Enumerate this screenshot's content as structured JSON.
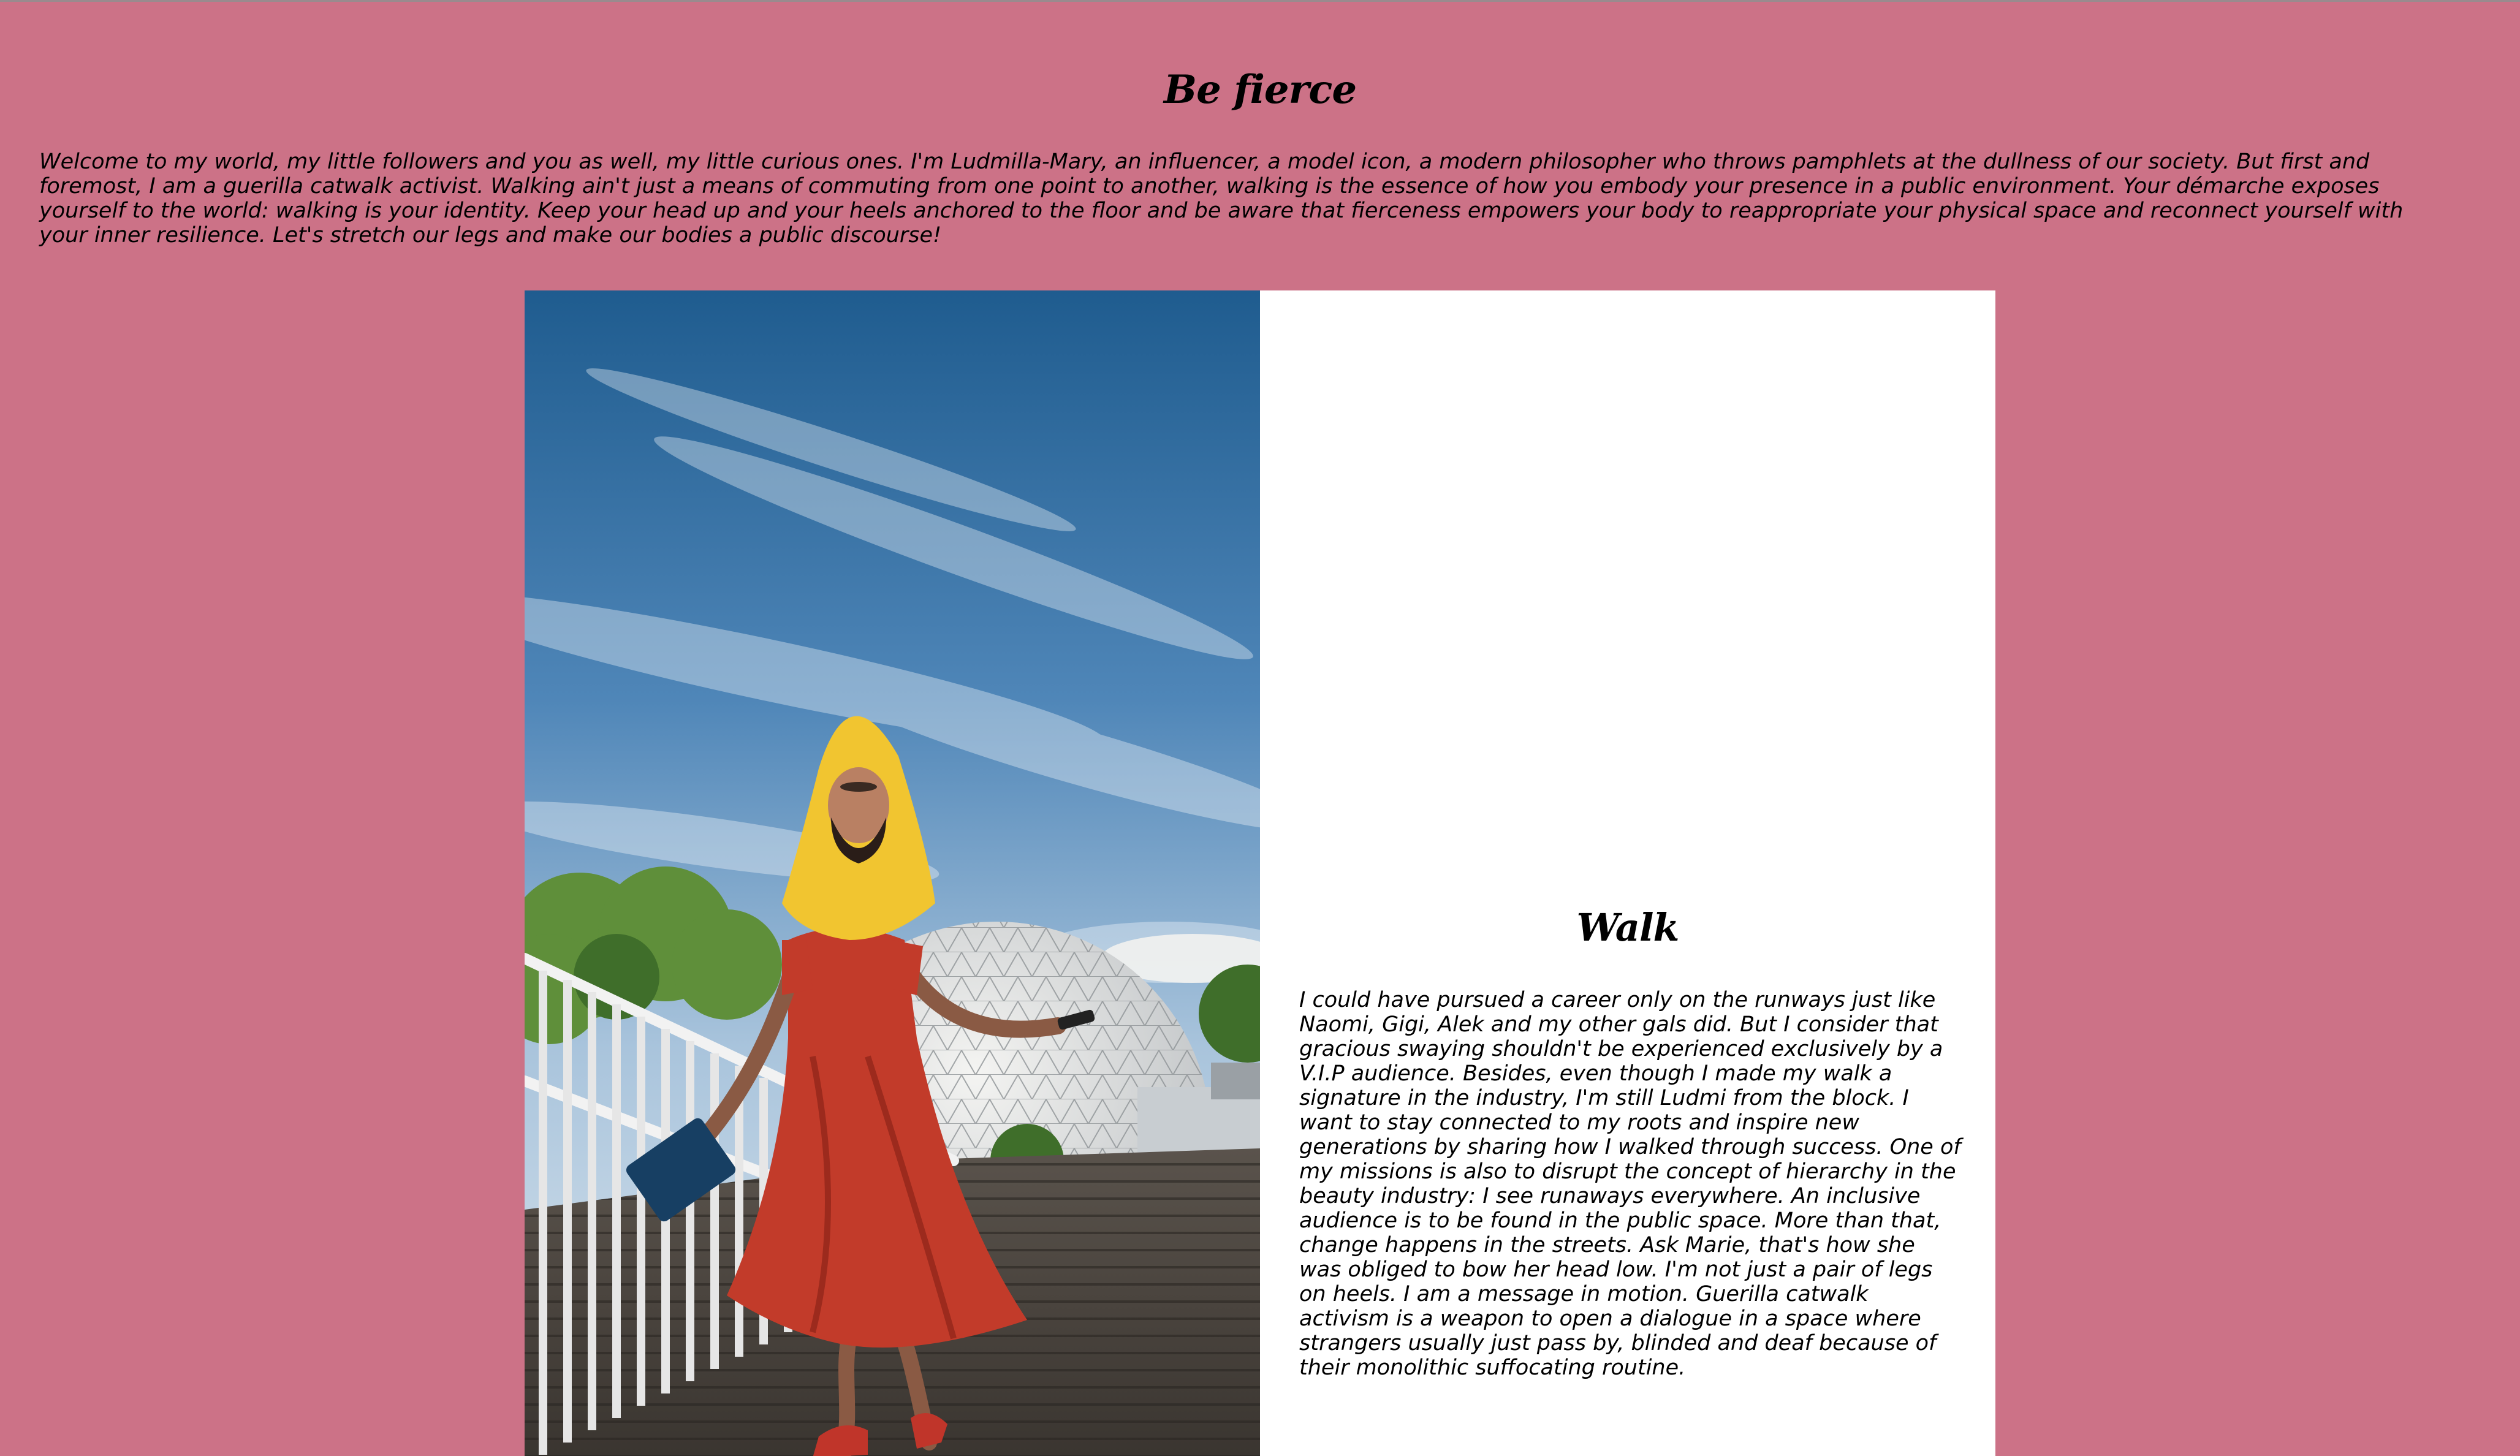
{
  "page": {
    "title": "Be fierce",
    "intro": "Welcome to my world, my little followers and you as well, my little curious ones. I'm Ludmilla-Mary, an influencer, a model icon, a modern philosopher who throws pamphlets at the dullness of our society. But first and foremost, I am a guerilla catwalk activist. Walking ain't just a means of commuting from one point to another, walking is the essence of how you embody your presence in a public environment. Your démarche exposes yourself to the world: walking is your identity. Keep your head up and your heels anchored to the floor and be aware that fierceness empowers your body to reappropriate your physical space and reconnect yourself with your inner resilience. Let's stretch our legs and make our bodies a public discourse!"
  },
  "section": {
    "title": "Walk",
    "body": "I could have pursued a career only on the runways just like Naomi, Gigi, Alek and my other gals did. But I consider that gracious swaying shouldn't be experienced exclusively by a V.I.P audience. Besides, even though I made my walk a signature in the industry, I'm still Ludmi from the block. I want to stay connected to my roots and inspire new generations by sharing how I walked through success. One of my missions is also to disrupt the concept of hierarchy in the beauty industry: I see runaways everywhere. An inclusive audience is to be found in the public space. More than that, change happens in the streets. Ask Marie, that's how she was obliged to bow her head low. I'm not just a pair of legs on heels. I am a message in motion. Guerilla catwalk activism is a weapon to open a dialogue in a space where strangers usually just pass by, blinded and deaf because of their monolithic suffocating routine."
  },
  "colors": {
    "background": "#cc7287",
    "panel": "#ffffff",
    "text": "#000000"
  }
}
